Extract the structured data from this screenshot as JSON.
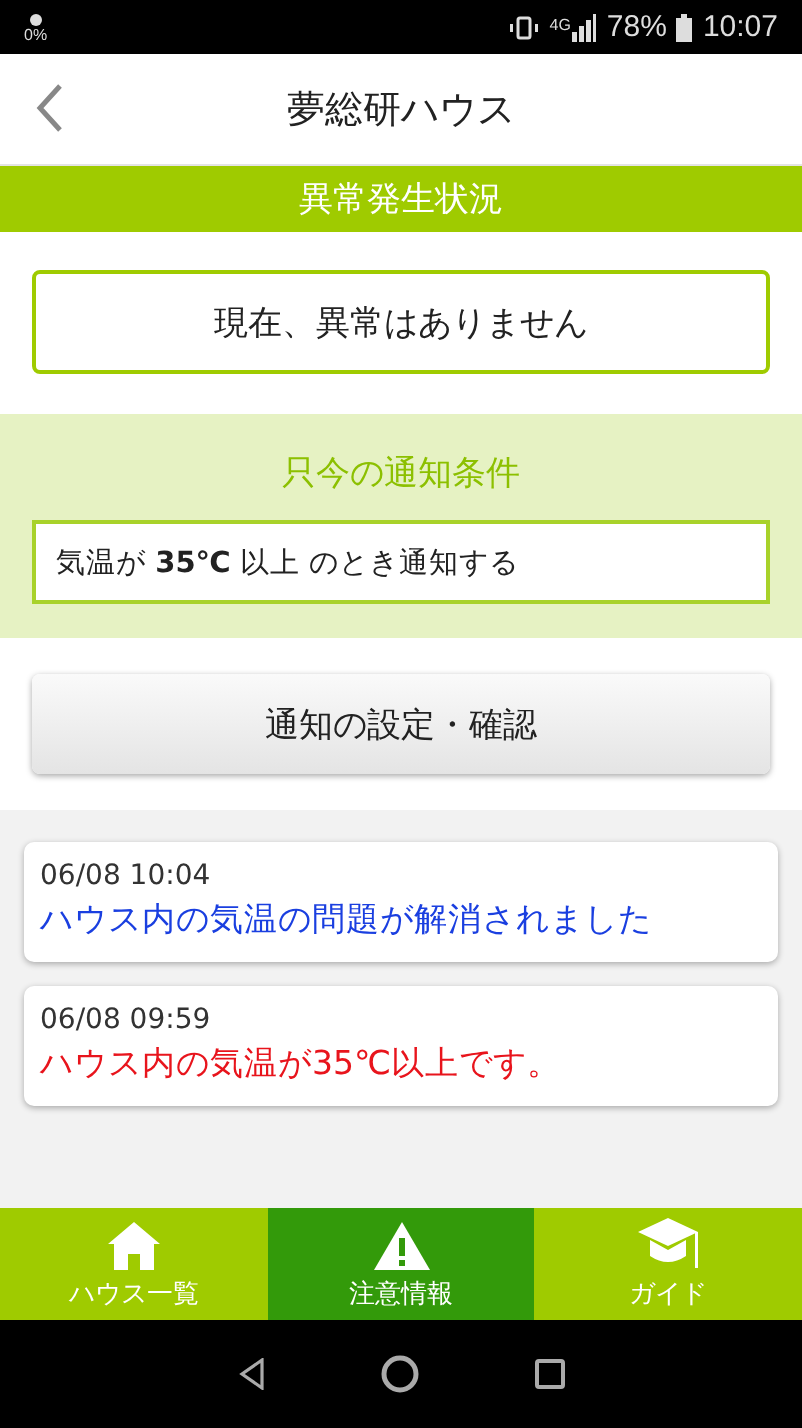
{
  "status_bar": {
    "brightness": "0%",
    "network": "4G",
    "battery": "78%",
    "time": "10:07"
  },
  "header": {
    "title": "夢総研ハウス"
  },
  "alarm_section": {
    "title": "異常発生状況",
    "message": "現在、異常はありません"
  },
  "condition_section": {
    "title": "只今の通知条件",
    "condition": "気温が **35℃** 以上 のとき通知する"
  },
  "settings_button": "通知の設定・確認",
  "notifications": [
    {
      "kind": "resolved",
      "time": "06/08 10:04",
      "message": "ハウス内の気温の問題が解消されました"
    },
    {
      "kind": "alert",
      "time": "06/08 09:59",
      "message": "ハウス内の気温が35℃以上です。"
    }
  ],
  "nav": [
    {
      "kind": "house",
      "label": "ハウス一覧",
      "selected": false
    },
    {
      "kind": "warning",
      "label": "注意情報",
      "selected": true
    },
    {
      "kind": "cap",
      "label": "ガイド",
      "selected": false
    }
  ]
}
